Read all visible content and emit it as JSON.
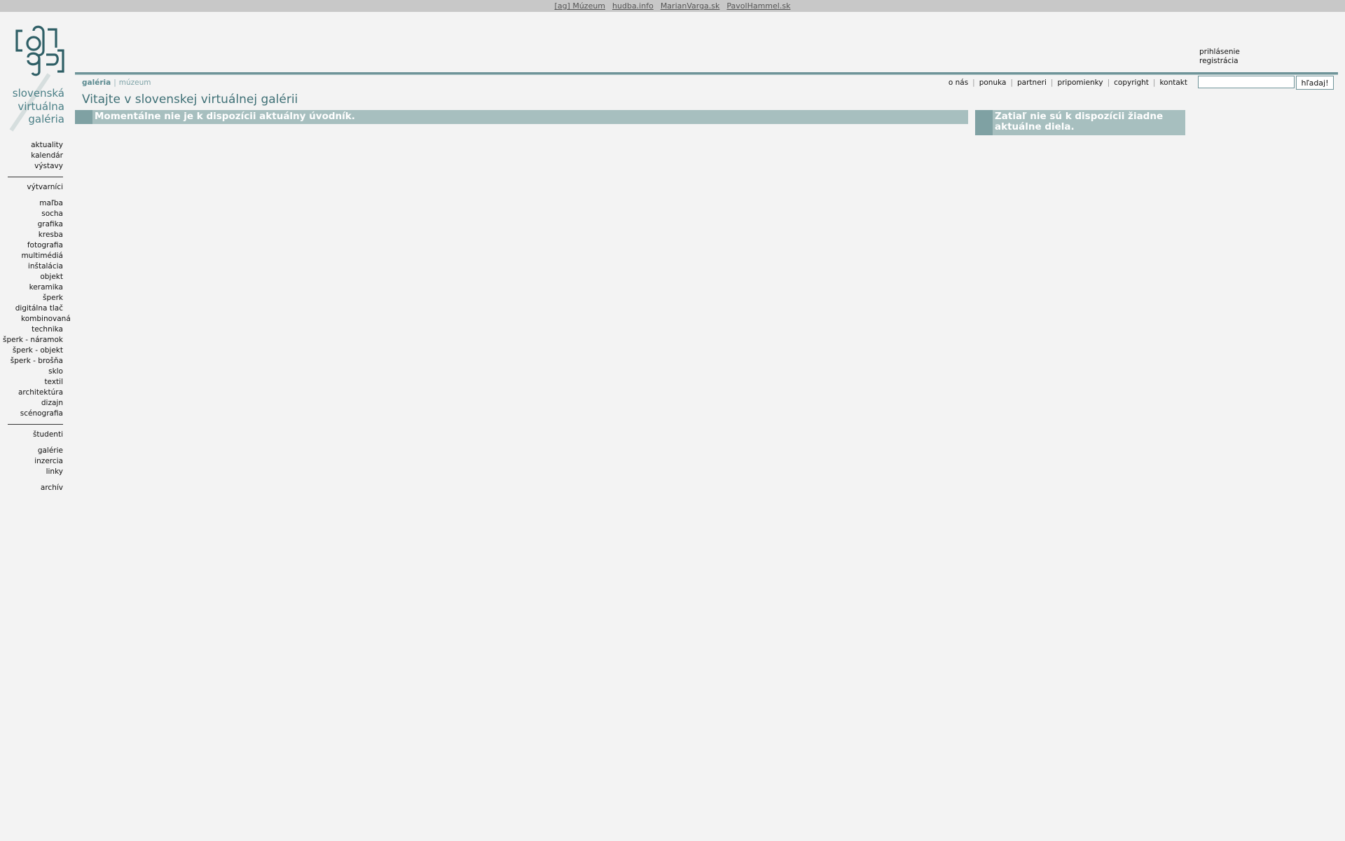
{
  "topbar": {
    "links": [
      "[ag] Múzeum",
      "hudba.info",
      "MarianVarga.sk",
      "PavolHammel.sk"
    ]
  },
  "logo": {
    "line1": "slovenská",
    "line2": "virtuálna",
    "line3": "galéria",
    "mark_icon": "ag-logo-mark",
    "accent_color": "#4a7f86"
  },
  "leftnav": {
    "group1": [
      "aktuality",
      "kalendár",
      "výstavy"
    ],
    "artists": "výtvarníci",
    "categories": [
      "maľba",
      "socha",
      "grafika",
      "kresba",
      "fotografia",
      "multimédiá",
      "inštalácia",
      "objekt",
      "keramika",
      "šperk",
      "digitálna tlač",
      "kombinovaná technika",
      "šperk - náramok",
      "šperk - objekt",
      "šperk - brošňa",
      "sklo",
      "textil",
      "architektúra",
      "dizajn",
      "scénografia"
    ],
    "students": "študenti",
    "group2": [
      "galérie",
      "inzercia",
      "linky"
    ],
    "archive": "archív"
  },
  "login": {
    "signin": "prihlásenie",
    "register": "registrácia"
  },
  "sections": {
    "active": "galéria",
    "inactive": "múzeum"
  },
  "topnav": {
    "items": [
      "o nás",
      "ponuka",
      "partneri",
      "pripomienky",
      "copyright",
      "kontakt"
    ]
  },
  "search": {
    "value": "",
    "button_label": "hľadaj!"
  },
  "page": {
    "title": "Vitajte v slovenskej virtuálnej galérii",
    "main_notice": "Momentálne nie je k dispozícii aktuálny úvodník.",
    "side_notice": "Zatiaľ nie sú k dispozícii žiadne aktuálne diela.",
    "box_color": "#a7bfbf",
    "stripe_color": "#7fa1a3"
  }
}
